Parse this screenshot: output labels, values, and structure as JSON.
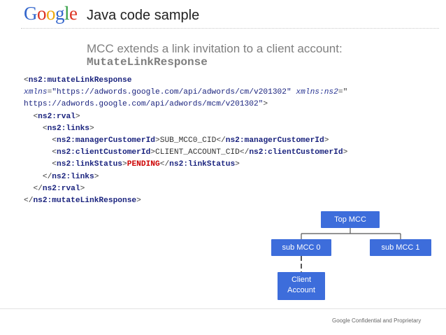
{
  "header": {
    "logo_letters": [
      {
        "char": "G",
        "color": "#3366cc"
      },
      {
        "char": "o",
        "color": "#dd3322"
      },
      {
        "char": "o",
        "color": "#eeaa11"
      },
      {
        "char": "g",
        "color": "#3366cc"
      },
      {
        "char": "l",
        "color": "#33a044"
      },
      {
        "char": "e",
        "color": "#dd3322"
      }
    ],
    "title": "Java code sample"
  },
  "subtitle": {
    "text": "MCC extends a link invitation to a client account:",
    "code": "MutateLinkResponse"
  },
  "code": {
    "l1_open": "<",
    "l1_tag": "ns2:mutateLinkResponse",
    "l2_attr1": "xmlns",
    "l2_eq1": "=",
    "l2_val1": "\"https://adwords.google.com/api/adwords/cm/v201302\"",
    "l2_attr2": "xmlns:ns2",
    "l2_eq2": "=\"",
    "l3_val2": "https://adwords.google.com/api/adwords/mcm/v201302\"",
    "l3_close": ">",
    "l4_indent": "  ",
    "l4_open": "<",
    "l4_tag": "ns2:rval",
    "l4_close": ">",
    "l5_indent": "    ",
    "l5_open": "<",
    "l5_tag": "ns2:links",
    "l5_close": ">",
    "l6_indent": "      ",
    "l6_open": "<",
    "l6_tag": "ns2:managerCustomerId",
    "l6_mid": ">",
    "l6_value": "SUB_MCC0_CID",
    "l6_end_open": "</",
    "l6_end_tag": "ns2:managerCustomerId",
    "l6_close": ">",
    "l7_indent": "      ",
    "l7_open": "<",
    "l7_tag": "ns2:clientCustomerId",
    "l7_mid": ">",
    "l7_value": "CLIENT_ACCOUNT_CID",
    "l7_end_open": "</",
    "l7_end_tag": "ns2:clientCustomerId",
    "l7_close": ">",
    "l8_indent": "      ",
    "l8_open": "<",
    "l8_tag": "ns2:linkStatus",
    "l8_mid": ">",
    "l8_value": "PENDING",
    "l8_end_open": "</",
    "l8_end_tag": "ns2:linkStatus",
    "l8_close": ">",
    "l9_indent": "    ",
    "l9_open": "</",
    "l9_tag": "ns2:links",
    "l9_close": ">",
    "l10_indent": "  ",
    "l10_open": "</",
    "l10_tag": "ns2:rval",
    "l10_close": ">",
    "l11_open": "</",
    "l11_tag": "ns2:mutateLinkResponse",
    "l11_close": ">"
  },
  "diagram": {
    "top": "Top MCC",
    "sub0": "sub MCC 0",
    "sub1": "sub MCC 1",
    "client_line1": "Client",
    "client_line2": "Account",
    "box_color": "#3d6ddb",
    "connector_color": "#555555"
  },
  "footer": {
    "text": "Google Confidential and Proprietary"
  }
}
